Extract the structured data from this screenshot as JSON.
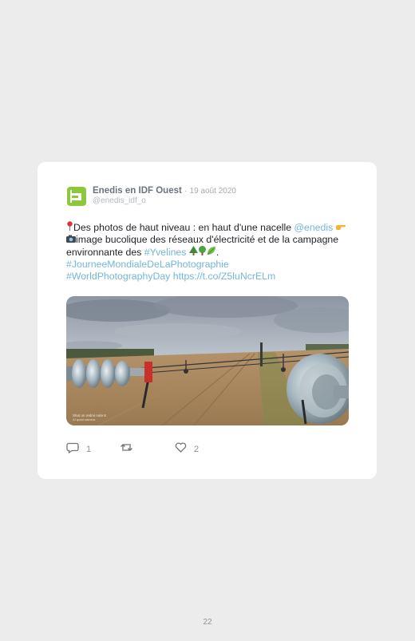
{
  "tweet": {
    "author_name": "Enedis en IDF Ouest",
    "separator": "·",
    "date": "19 août 2020",
    "handle": "@enedis_idf_o",
    "text_1": "Des photos de haut niveau : en haut d'une nacelle",
    "mention": "@enedis",
    "text_2": "image bucolique des réseaux d'électricité et de la campagne environnante des",
    "hashtag_1": "#Yvelines",
    "text_3": ".",
    "hashtag_2": "#JourneeMondialeDeLaPhotographie",
    "hashtag_3": "#WorldPhotographyDay",
    "url": "https://t.co/Z5luNcrELm",
    "photo_watermark_1": "Shot on redmi note 8",
    "photo_watermark_2": "AI quad camera",
    "reply_count": "1",
    "retweet_count": "",
    "like_count": "2"
  },
  "icons": {
    "pin": "round-pushpin-icon",
    "pointing": "backhand-index-pointing-right-icon",
    "camera": "camera-icon",
    "tree_1": "evergreen-tree-icon",
    "tree_2": "deciduous-tree-icon",
    "leaf": "leaf-icon",
    "reply": "reply-icon",
    "retweet": "retweet-icon",
    "like": "heart-icon"
  },
  "colors": {
    "brand_green": "#8dc63f",
    "link_blue": "#74b6d8",
    "page_background": "#ececec"
  },
  "page": {
    "number": "22"
  }
}
